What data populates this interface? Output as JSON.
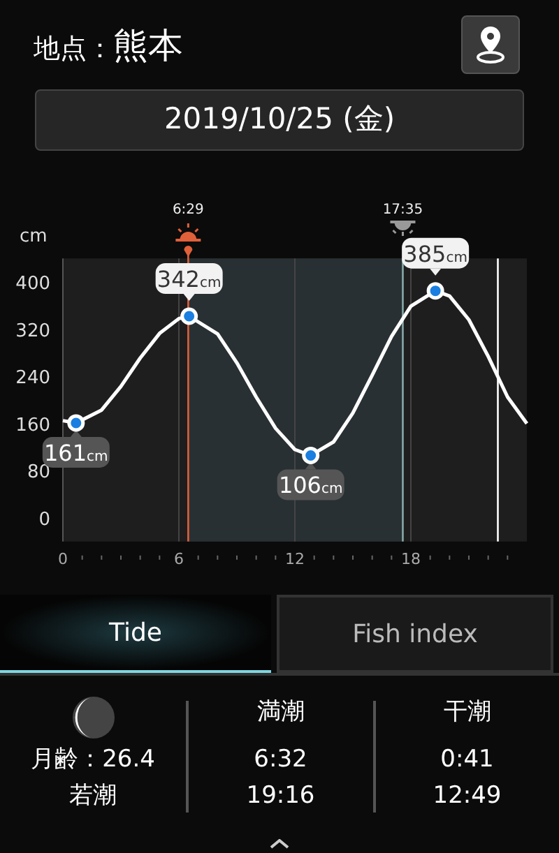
{
  "location": {
    "label": "地点：",
    "name": "熊本"
  },
  "date": "2019/10/25 (金)",
  "chart": {
    "chart_data": {
      "type": "line",
      "ylabel": "cm",
      "x": [
        0,
        0.68,
        2,
        3,
        4,
        5,
        6,
        6.53,
        8,
        9,
        10,
        11,
        12,
        12.82,
        14,
        15,
        16,
        17,
        18,
        19.27,
        20,
        21,
        22,
        23,
        24
      ],
      "series": [
        {
          "color": "#ffffff",
          "values": [
            165,
            161,
            183,
            223,
            271,
            313,
            338,
            342,
            312,
            263,
            205,
            152,
            116,
            106,
            129,
            178,
            242,
            308,
            359,
            385,
            376,
            336,
            274,
            205,
            160
          ]
        }
      ],
      "xlim": [
        0,
        24
      ],
      "ylim": [
        -40,
        440
      ],
      "xticks": [
        0,
        6,
        12,
        18
      ],
      "yticks": [
        0,
        80,
        160,
        240,
        320,
        400
      ],
      "grid": true,
      "annotations": [
        {
          "text": "161cm",
          "x": 0.68,
          "y": 161
        },
        {
          "text": "342cm",
          "x": 6.53,
          "y": 342
        },
        {
          "text": "106cm",
          "x": 12.82,
          "y": 106
        },
        {
          "text": "385cm",
          "x": 19.27,
          "y": 385
        }
      ],
      "ref_lines": [
        {
          "axis": "x",
          "value": 6.483,
          "color": "#e0603a"
        },
        {
          "axis": "x",
          "value": 17.583,
          "color": "#88aaaa"
        },
        {
          "axis": "x",
          "value": 22.5,
          "color": "#ffffff"
        }
      ],
      "bands": [
        {
          "axis": "x",
          "from": 6.483,
          "to": 17.583,
          "color": "#283033"
        }
      ]
    },
    "sun_times": [
      {
        "kind": "sunrise",
        "time": "6:29"
      },
      {
        "kind": "sunset",
        "time": "17:35"
      }
    ]
  },
  "tabs": [
    {
      "label": "Tide",
      "selected": true
    },
    {
      "label": "Fish index",
      "selected": false
    }
  ],
  "moon": {
    "age": "月齢：26.4",
    "tide_name": "若潮"
  },
  "tide_columns": [
    {
      "title": "満潮",
      "times": [
        "6:32",
        "19:16"
      ]
    },
    {
      "title": "干潮",
      "times": [
        "0:41",
        "12:49"
      ]
    }
  ]
}
